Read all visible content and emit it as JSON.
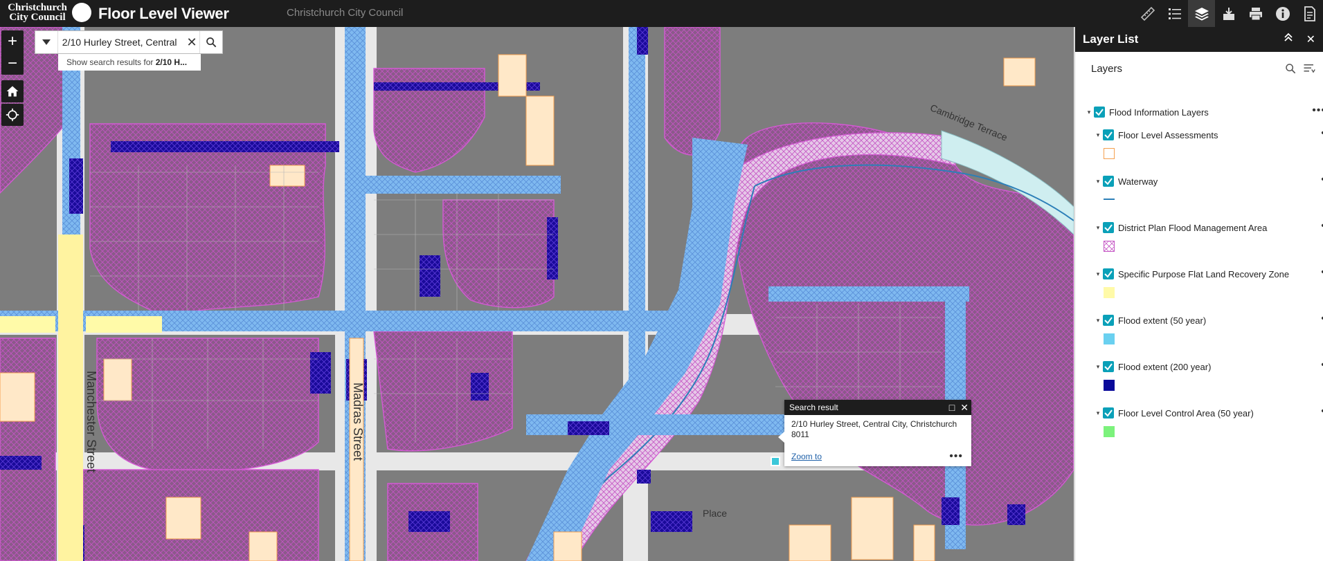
{
  "header": {
    "logo_line1": "Christchurch",
    "logo_line2": "City Council",
    "app_title": "Floor Level Viewer",
    "subtitle": "Christchurch City Council",
    "tools": [
      "measure-icon",
      "legend-icon",
      "layers-icon",
      "basemap-icon",
      "print-icon",
      "info-icon",
      "report-icon"
    ]
  },
  "map": {
    "zoom_in": "+",
    "zoom_out": "−",
    "search": {
      "value": "2/10 Hurley Street, Central",
      "suggestion_prefix": "Show search results for ",
      "suggestion_bold": "2/10 H..."
    },
    "streets": {
      "manchester": "Manchester Street",
      "madras": "Madras Street",
      "cambridge": "Cambridge Terrace",
      "place": "Place"
    },
    "colors": {
      "parcel": "#7d7d7d",
      "flood_district": "#8b5a8a",
      "flood_50": "#7fb9f0",
      "flood_200": "#1a0a9a",
      "recovery_zone": "#fffaa8",
      "assessment": "#f5a050",
      "river": "#cfeef0"
    }
  },
  "popup": {
    "title": "Search result",
    "address": "2/10 Hurley Street, Central City, Christchurch 8011",
    "zoom_link": "Zoom to",
    "more": "•••"
  },
  "layer_list": {
    "title": "Layer List",
    "subtitle": "Layers",
    "group": "Flood Information Layers",
    "layers": [
      {
        "label": "Floor Level Assessments",
        "swatch": "outline-orange"
      },
      {
        "label": "Waterway",
        "swatch": "line-blue"
      },
      {
        "label": "District Plan Flood Management Area",
        "swatch": "hatch-magenta"
      },
      {
        "label": "Specific Purpose Flat Land Recovery Zone",
        "swatch": "fill-yellow"
      },
      {
        "label": "Flood extent (50 year)",
        "swatch": "fill-lightblue"
      },
      {
        "label": "Flood extent (200 year)",
        "swatch": "fill-navy"
      },
      {
        "label": "Floor Level Control Area (50 year)",
        "swatch": "fill-green"
      }
    ]
  }
}
